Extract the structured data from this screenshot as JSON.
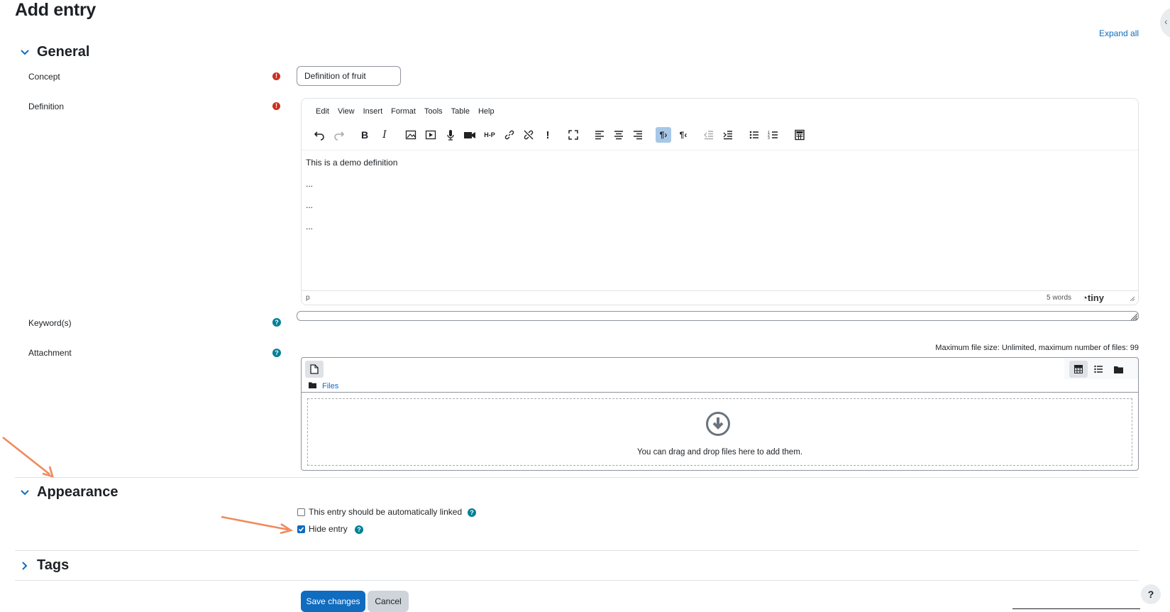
{
  "page": {
    "title": "Add entry",
    "expand_all": "Expand all"
  },
  "sections": {
    "general": "General",
    "appearance": "Appearance",
    "tags": "Tags"
  },
  "fields": {
    "concept": {
      "label": "Concept",
      "value": "Definition of fruit"
    },
    "definition": {
      "label": "Definition"
    },
    "keywords": {
      "label": "Keyword(s)",
      "value": ""
    },
    "attachment": {
      "label": "Attachment",
      "max_info": "Maximum file size: Unlimited, maximum number of files: 99",
      "files_link": "Files",
      "drop_hint": "You can drag and drop files here to add them."
    }
  },
  "editor": {
    "menu": [
      "Edit",
      "View",
      "Insert",
      "Format",
      "Tools",
      "Table",
      "Help"
    ],
    "content": [
      "This is a demo definition",
      "...",
      "...",
      "..."
    ],
    "status_path": "p",
    "word_count": "5 words",
    "brand": "tiny"
  },
  "appearance": {
    "auto_link_label": "This entry should be automatically linked",
    "auto_link_checked": false,
    "hide_entry_label": "Hide entry",
    "hide_entry_checked": true
  },
  "buttons": {
    "save": "Save changes",
    "cancel": "Cancel",
    "help": "?"
  },
  "colors": {
    "accent": "#0f6cbf",
    "required": "#ca3120",
    "help": "#008196",
    "annotation": "#f08a5d"
  }
}
